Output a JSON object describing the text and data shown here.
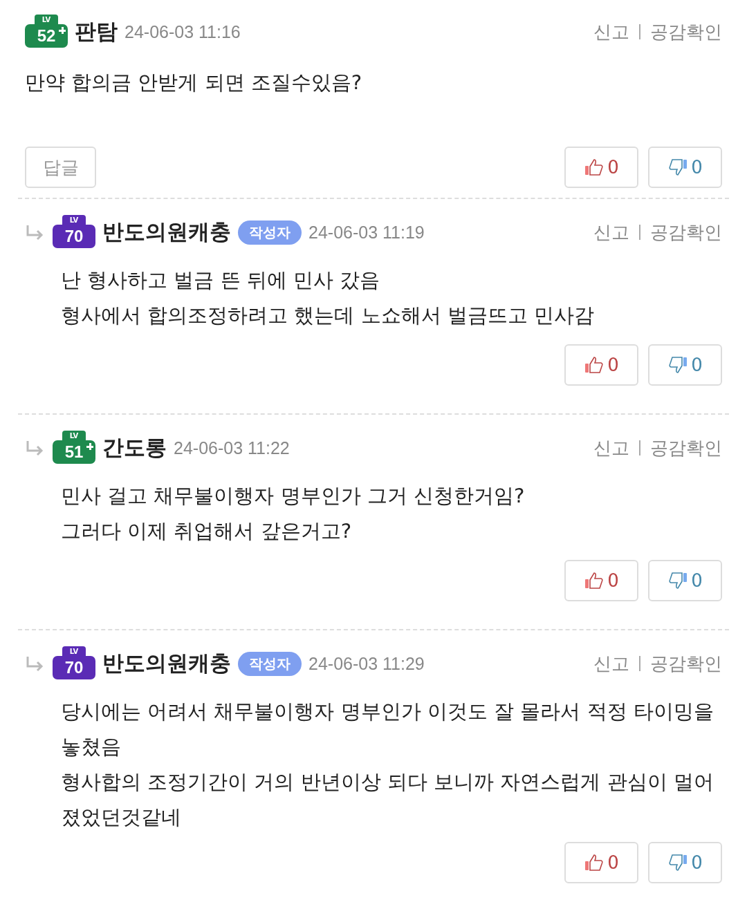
{
  "comments": [
    {
      "reply": false,
      "badge": {
        "lv": "LV",
        "level": "52",
        "plus": true,
        "color": "#1e8a4e"
      },
      "author": "판탐",
      "is_writer": false,
      "time": "24-06-03 11:16",
      "report": "신고",
      "empathy": "공감확인",
      "lines": [
        "만약 합의금 안받게 되면 조질수있음?"
      ],
      "reply_button": "답글",
      "likes": "0",
      "dislikes": "0"
    },
    {
      "reply": true,
      "badge": {
        "lv": "LV",
        "level": "70",
        "plus": false,
        "color": "#5a2bb5"
      },
      "author": "반도의원캐충",
      "is_writer": true,
      "writer_tag": "작성자",
      "time": "24-06-03 11:19",
      "report": "신고",
      "empathy": "공감확인",
      "lines": [
        "난 형사하고 벌금 뜬 뒤에 민사 갔음",
        "형사에서 합의조정하려고 했는데 노쇼해서 벌금뜨고 민사감"
      ],
      "likes": "0",
      "dislikes": "0"
    },
    {
      "reply": true,
      "badge": {
        "lv": "LV",
        "level": "51",
        "plus": true,
        "color": "#1e8a4e"
      },
      "author": "간도롱",
      "is_writer": false,
      "time": "24-06-03 11:22",
      "report": "신고",
      "empathy": "공감확인",
      "lines": [
        "민사 걸고 채무불이행자 명부인가 그거 신청한거임?",
        "그러다 이제 취업해서 갚은거고?"
      ],
      "likes": "0",
      "dislikes": "0"
    },
    {
      "reply": true,
      "badge": {
        "lv": "LV",
        "level": "70",
        "plus": false,
        "color": "#5a2bb5"
      },
      "author": "반도의원캐충",
      "is_writer": true,
      "writer_tag": "작성자",
      "time": "24-06-03 11:29",
      "report": "신고",
      "empathy": "공감확인",
      "lines": [
        "당시에는 어려서 채무불이행자 명부인가 이것도 잘 몰라서 적정 타이밍을 놓쳤음",
        "형사합의 조정기간이 거의 반년이상 되다 보니까 자연스럽게 관심이 멀어졌었던것같네"
      ],
      "likes": "0",
      "dislikes": "0"
    }
  ]
}
